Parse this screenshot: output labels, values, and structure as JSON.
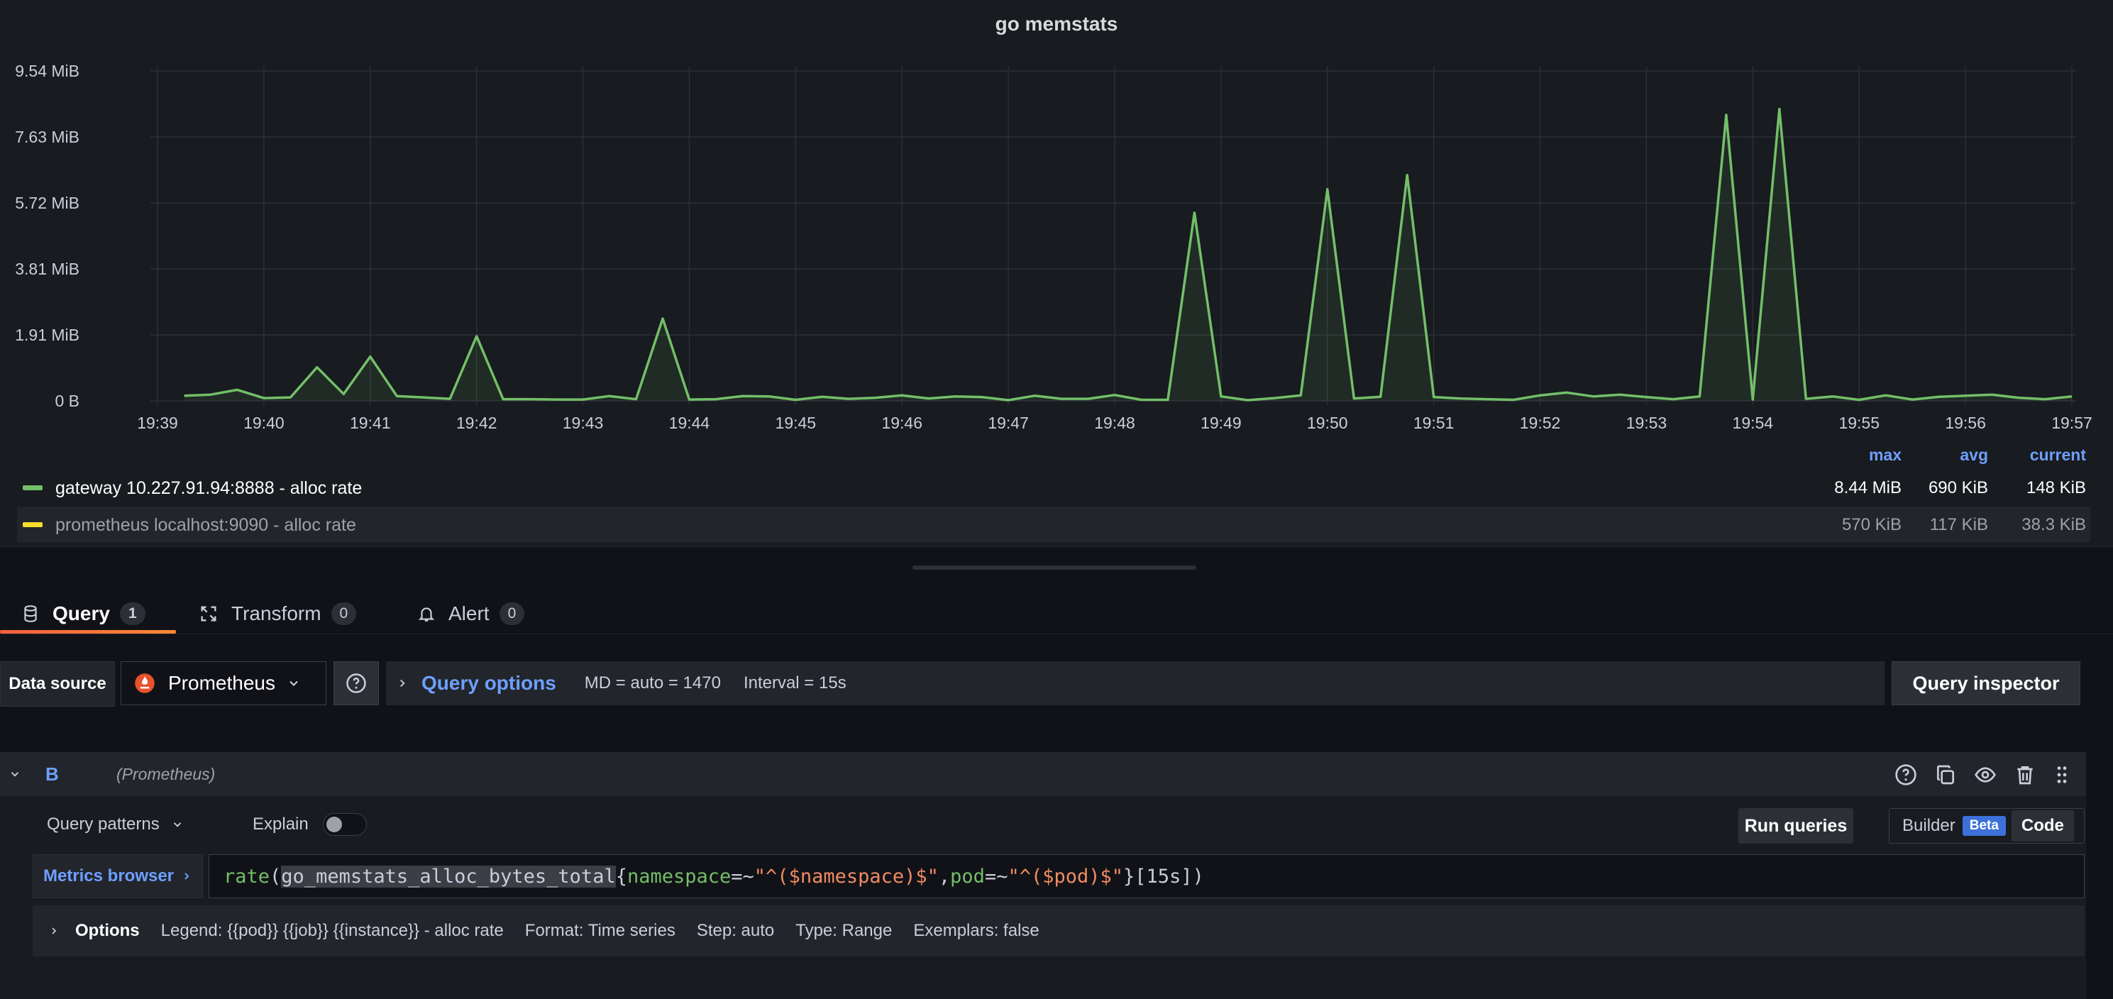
{
  "panel": {
    "title": "go memstats"
  },
  "chart_data": {
    "type": "line",
    "title": "go memstats",
    "y_ticks": [
      "0 B",
      "1.91 MiB",
      "3.81 MiB",
      "5.72 MiB",
      "7.63 MiB",
      "9.54 MiB"
    ],
    "ylim_mib": [
      0,
      9.54
    ],
    "x_ticks": [
      "19:39",
      "19:40",
      "19:41",
      "19:42",
      "19:43",
      "19:44",
      "19:45",
      "19:46",
      "19:47",
      "19:48",
      "19:49",
      "19:50",
      "19:51",
      "19:52",
      "19:53",
      "19:54",
      "19:55",
      "19:56",
      "19:57"
    ],
    "x_minutes_range": [
      19.0,
      57.0
    ],
    "series": [
      {
        "name": "gateway 10.227.91.94:8888 - alloc rate",
        "color": "#73bf69",
        "x_minutes": [
          39.25,
          39.5,
          39.75,
          40.0,
          40.25,
          40.5,
          40.75,
          41.0,
          41.25,
          41.5,
          41.75,
          42.0,
          42.25,
          42.5,
          42.75,
          43.0,
          43.25,
          43.5,
          43.75,
          44.0,
          44.25,
          44.5,
          44.75,
          45.0,
          45.25,
          45.5,
          45.75,
          46.0,
          46.25,
          46.5,
          46.75,
          47.0,
          47.25,
          47.5,
          47.75,
          48.0,
          48.25,
          48.5,
          48.75,
          49.0,
          49.25,
          49.5,
          49.75,
          50.0,
          50.25,
          50.5,
          50.75,
          51.0,
          51.25,
          51.5,
          51.75,
          52.0,
          52.25,
          52.5,
          52.75,
          53.0,
          53.25,
          53.5,
          53.75,
          54.0,
          54.25,
          54.5,
          54.75,
          55.0,
          55.25,
          55.5,
          55.75,
          56.0,
          56.25,
          56.5,
          56.75,
          57.0
        ],
        "values_mib": [
          0.15,
          0.18,
          0.32,
          0.08,
          0.1,
          0.97,
          0.2,
          1.28,
          0.14,
          0.1,
          0.06,
          1.87,
          0.05,
          0.05,
          0.04,
          0.04,
          0.14,
          0.05,
          2.38,
          0.04,
          0.05,
          0.14,
          0.13,
          0.03,
          0.12,
          0.06,
          0.09,
          0.16,
          0.07,
          0.13,
          0.11,
          0.02,
          0.15,
          0.06,
          0.06,
          0.17,
          0.03,
          0.03,
          5.44,
          0.13,
          0.02,
          0.08,
          0.16,
          6.12,
          0.07,
          0.12,
          6.53,
          0.11,
          0.07,
          0.05,
          0.03,
          0.16,
          0.24,
          0.13,
          0.18,
          0.11,
          0.05,
          0.13,
          8.27,
          0.04,
          8.44,
          0.06,
          0.13,
          0.03,
          0.16,
          0.04,
          0.12,
          0.15,
          0.18,
          0.09,
          0.05,
          0.13
        ]
      }
    ],
    "legend": {
      "headers": {
        "max": "max",
        "avg": "avg",
        "current": "current"
      },
      "rows": [
        {
          "name": "gateway 10.227.91.94:8888 - alloc rate",
          "color": "#73bf69",
          "max": "8.44 MiB",
          "avg": "690 KiB",
          "current": "148 KiB"
        },
        {
          "name": "prometheus localhost:9090 - alloc rate",
          "color": "#fade2a",
          "max": "570 KiB",
          "avg": "117 KiB",
          "current": "38.3 KiB"
        }
      ]
    }
  },
  "tabs": [
    {
      "label": "Query",
      "count": "1"
    },
    {
      "label": "Transform",
      "count": "0"
    },
    {
      "label": "Alert",
      "count": "0"
    }
  ],
  "toolbar": {
    "datasource_label": "Data source",
    "datasource_value": "Prometheus",
    "query_options_label": "Query options",
    "md": "MD = auto = 1470",
    "interval": "Interval = 15s",
    "query_inspector": "Query inspector"
  },
  "query": {
    "ref_id": "B",
    "datasource": "(Prometheus)",
    "patterns": "Query patterns",
    "explain": "Explain",
    "run_queries": "Run queries",
    "builder": "Builder",
    "beta": "Beta",
    "code": "Code",
    "metrics_browser": "Metrics browser",
    "expr": {
      "fn": "rate",
      "p1": "(",
      "metric": "go_memstats_alloc_bytes_total",
      "b1": "{",
      "l1": "namespace",
      "op1": "=~",
      "v1": "\"^($namespace)$\"",
      "comma": ",",
      "l2": "pod",
      "op2": "=~",
      "v2": "\"^($pod)$\"",
      "b2": "}",
      "range": "[15s]",
      "p2": ")"
    },
    "options": {
      "label": "Options",
      "legend": "Legend: {{pod}} {{job}} {{instance}} - alloc rate",
      "format": "Format: Time series",
      "step": "Step: auto",
      "type": "Type: Range",
      "exemplars": "Exemplars: false"
    }
  }
}
